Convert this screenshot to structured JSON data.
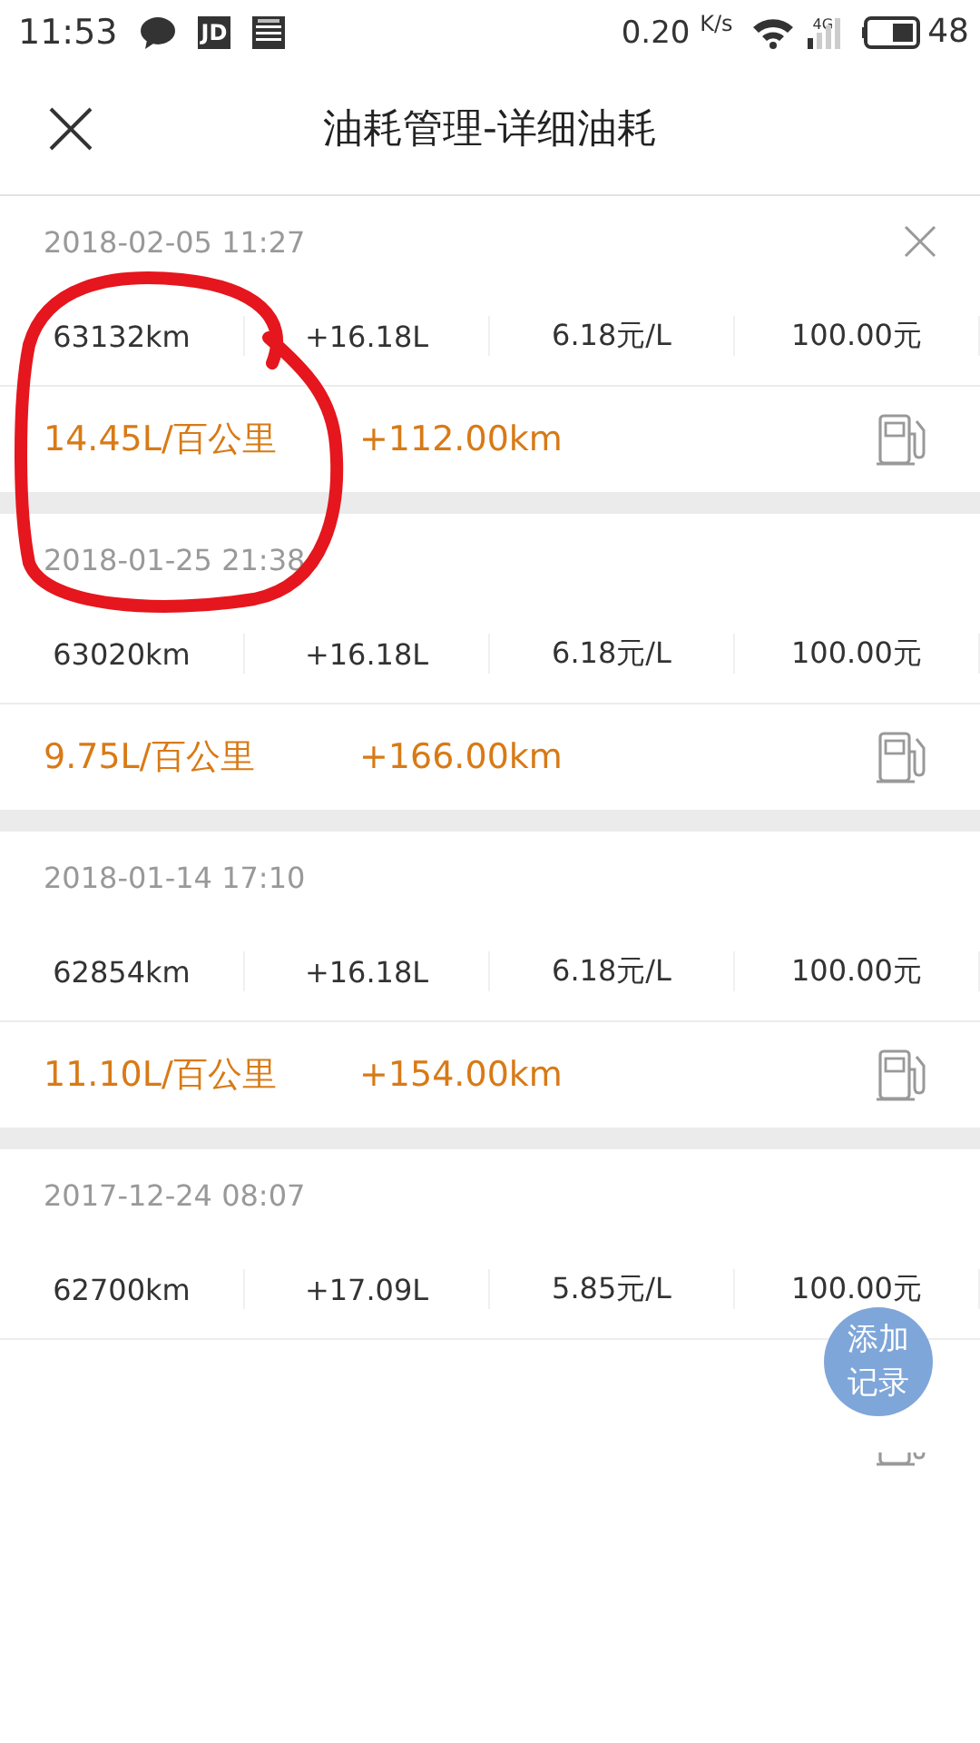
{
  "status_bar": {
    "time": "11:53",
    "app_badge": "JD",
    "speed": "0.20",
    "speed_unit": "K/s",
    "network": "4G",
    "battery": "48"
  },
  "header": {
    "title": "油耗管理-详细油耗"
  },
  "records": [
    {
      "date": "2018-02-05 11:27",
      "deletable": true,
      "odometer": "63132km",
      "fuel": "+16.18L",
      "price": "6.18元/L",
      "cost": "100.00元",
      "consumption": "14.45L/百公里",
      "distance": "+112.00km"
    },
    {
      "date": "2018-01-25 21:38",
      "deletable": false,
      "odometer": "63020km",
      "fuel": "+16.18L",
      "price": "6.18元/L",
      "cost": "100.00元",
      "consumption": "9.75L/百公里",
      "distance": "+166.00km"
    },
    {
      "date": "2018-01-14 17:10",
      "deletable": false,
      "odometer": "62854km",
      "fuel": "+16.18L",
      "price": "6.18元/L",
      "cost": "100.00元",
      "consumption": "11.10L/百公里",
      "distance": "+154.00km"
    },
    {
      "date": "2017-12-24 08:07",
      "deletable": false,
      "odometer": "62700km",
      "fuel": "+17.09L",
      "price": "5.85元/L",
      "cost": "100.00元"
    }
  ],
  "add_button": {
    "label": "添加记录"
  },
  "annotation": {
    "kind": "circle"
  }
}
